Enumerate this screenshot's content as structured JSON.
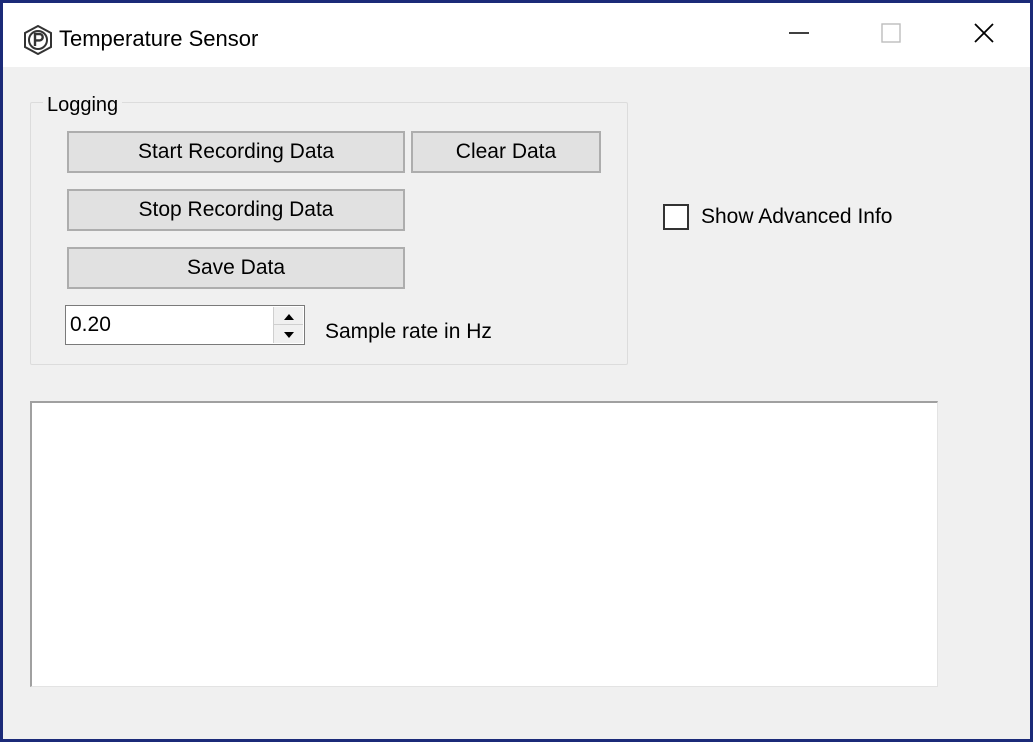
{
  "window": {
    "title": "Temperature Sensor",
    "app_icon": "p-logo-icon",
    "controls": {
      "minimize_icon": "minimize-icon",
      "maximize_icon": "maximize-icon",
      "close_icon": "close-icon"
    }
  },
  "logging": {
    "group_label": "Logging",
    "start_label": "Start Recording Data",
    "clear_label": "Clear Data",
    "stop_label": "Stop Recording Data",
    "save_label": "Save Data",
    "sample_rate": {
      "value": "0.20",
      "label": "Sample rate in Hz"
    }
  },
  "advanced": {
    "label": "Show Advanced Info",
    "checked": false
  },
  "output": {
    "text": ""
  },
  "colors": {
    "border": "#1b2a78",
    "background": "#f0f0f0",
    "button_face": "#e1e1e1"
  }
}
